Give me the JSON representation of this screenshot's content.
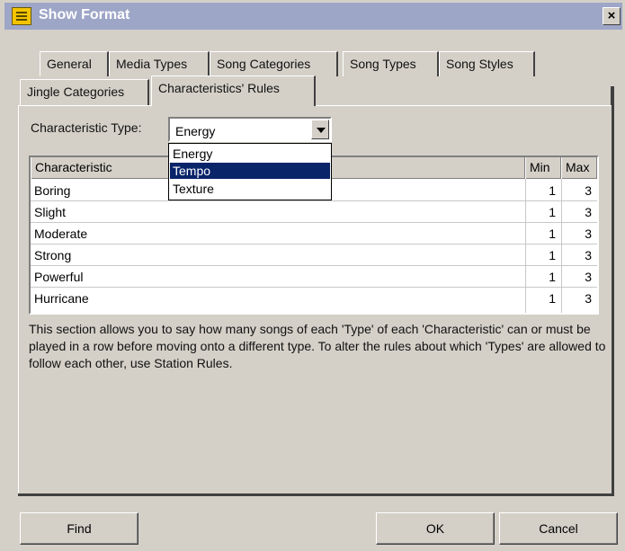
{
  "window": {
    "title": "Show Format",
    "close_label": "×"
  },
  "tabs_row1": [
    "General",
    "Media Types",
    "Song Categories",
    "Song Types",
    "Song Styles"
  ],
  "tabs_row2": [
    "Jingle Categories",
    "Characteristics' Rules"
  ],
  "active_tab": "Characteristics' Rules",
  "characteristic_type": {
    "label": "Characteristic Type:",
    "value": "Energy",
    "options": [
      "Energy",
      "Tempo",
      "Texture"
    ],
    "highlighted": "Tempo"
  },
  "table": {
    "columns": [
      "Characteristic",
      "Min",
      "Max"
    ],
    "rows": [
      {
        "name": "Boring",
        "min": "1",
        "max": "3"
      },
      {
        "name": "Slight",
        "min": "1",
        "max": "3"
      },
      {
        "name": "Moderate",
        "min": "1",
        "max": "3"
      },
      {
        "name": "Strong",
        "min": "1",
        "max": "3"
      },
      {
        "name": "Powerful",
        "min": "1",
        "max": "3"
      },
      {
        "name": "Hurricane",
        "min": "1",
        "max": "3"
      }
    ]
  },
  "description": "This section allows you to say how many songs of each 'Type' of each 'Characteristic' can or must be played in a row before moving onto a different type. To alter the rules about which 'Types' are allowed to follow each other, use Station Rules.",
  "buttons": {
    "find": "Find",
    "ok": "OK",
    "cancel": "Cancel"
  }
}
